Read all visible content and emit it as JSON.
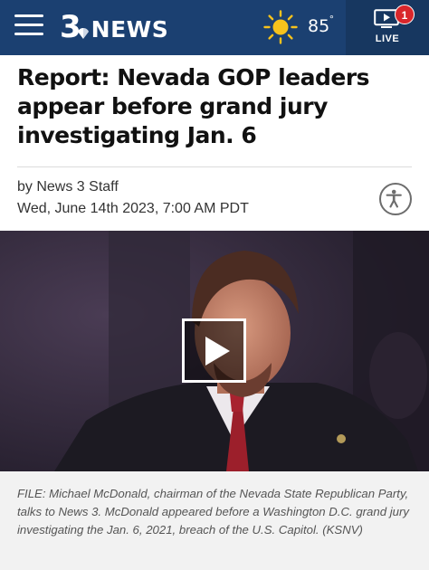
{
  "header": {
    "logo_number": "3",
    "logo_text": "NEWS",
    "weather": {
      "temperature": "85",
      "degree_symbol": "°",
      "icon": "sun-icon"
    },
    "live": {
      "label": "LIVE",
      "badge_count": "1",
      "icon": "tv-play-icon"
    },
    "colors": {
      "background": "#1b4071",
      "live_panel": "#173760",
      "badge": "#d9262b",
      "sun": "#f6c21c"
    }
  },
  "article": {
    "headline": "Report: Nevada GOP leaders appear before grand jury investigating Jan. 6",
    "byline": "by News 3 Staff",
    "date": "Wed, June 14th 2023, 7:00 AM PDT",
    "accessibility_icon": "accessibility-icon"
  },
  "media": {
    "play_icon": "play-icon",
    "caption": "FILE: Michael McDonald, chairman of the Nevada State Republican Party, talks to News 3. McDonald appeared before a Washington D.C. grand jury investigating the Jan. 6, 2021, breach of the U.S. Capitol. (KSNV)"
  }
}
